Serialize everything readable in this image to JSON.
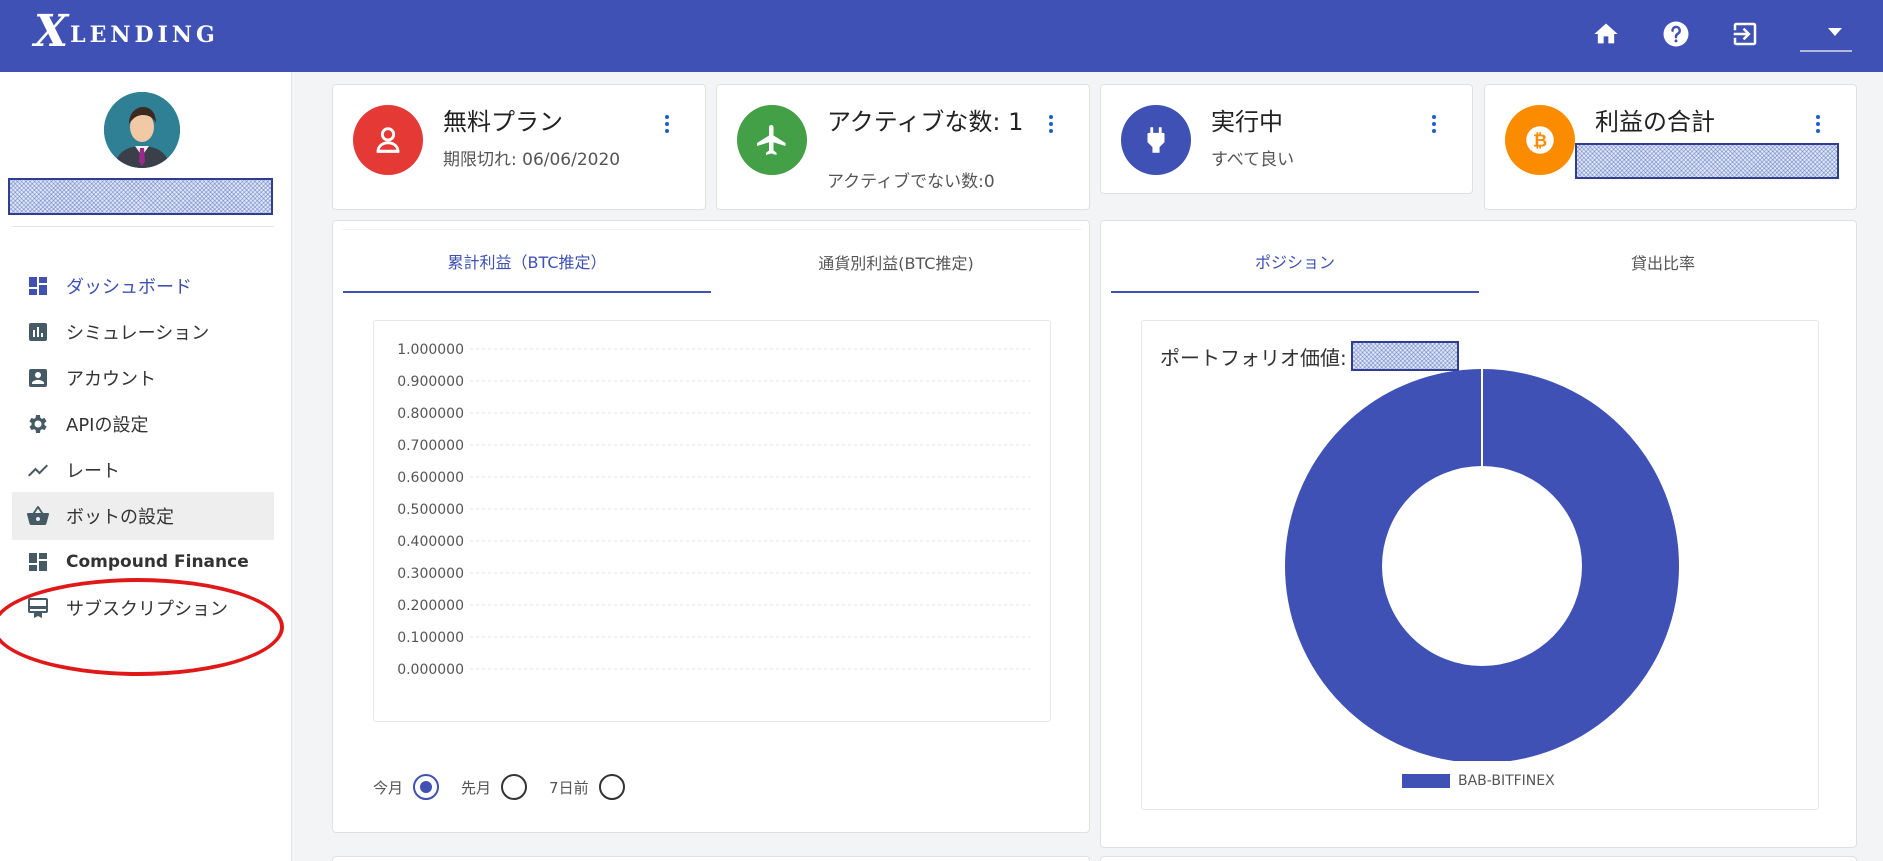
{
  "topbar": {
    "logo_big": "X",
    "logo_small": "LENDING"
  },
  "sidebar": {
    "items": [
      {
        "label": "ダッシュボード"
      },
      {
        "label": "シミュレーション"
      },
      {
        "label": "アカウント"
      },
      {
        "label": "APIの設定"
      },
      {
        "label": "レート"
      },
      {
        "label": "ボットの設定"
      },
      {
        "label": "Compound Finance"
      },
      {
        "label": "サブスクリプション"
      }
    ]
  },
  "cards": [
    {
      "title": "無料プラン",
      "subtitle": "期限切れ: 06/06/2020"
    },
    {
      "title": "アクティブな数: 1",
      "subtitle": "アクティブでない数:0"
    },
    {
      "title": "実行中",
      "subtitle": "すべて良い"
    },
    {
      "title": "利益の合計",
      "subtitle": ""
    }
  ],
  "left_panel": {
    "tabs": [
      "累計利益（BTC推定）",
      "通貨別利益(BTC推定)"
    ],
    "radios": [
      {
        "label": "今月",
        "checked": true
      },
      {
        "label": "先月",
        "checked": false
      },
      {
        "label": "7日前",
        "checked": false
      }
    ]
  },
  "right_panel": {
    "tabs": [
      "ポジション",
      "貸出比率"
    ],
    "portfolio_label": "ポートフォリオ価値:"
  },
  "colors": {
    "primary": "#3f51b5",
    "red": "#e53935",
    "green": "#43a047",
    "orange": "#fb8c00"
  },
  "chart_data": [
    {
      "type": "line",
      "title": "",
      "x": [],
      "series": [],
      "ylim": [
        0,
        1
      ],
      "y_ticks": [
        "1.000000",
        "0.900000",
        "0.800000",
        "0.700000",
        "0.600000",
        "0.500000",
        "0.400000",
        "0.300000",
        "0.200000",
        "0.100000",
        "0.000000"
      ],
      "grid": true
    },
    {
      "type": "pie",
      "donut": true,
      "categories": [
        "BAB-BITFINEX"
      ],
      "values": [
        100
      ],
      "legend": "bottom"
    }
  ]
}
